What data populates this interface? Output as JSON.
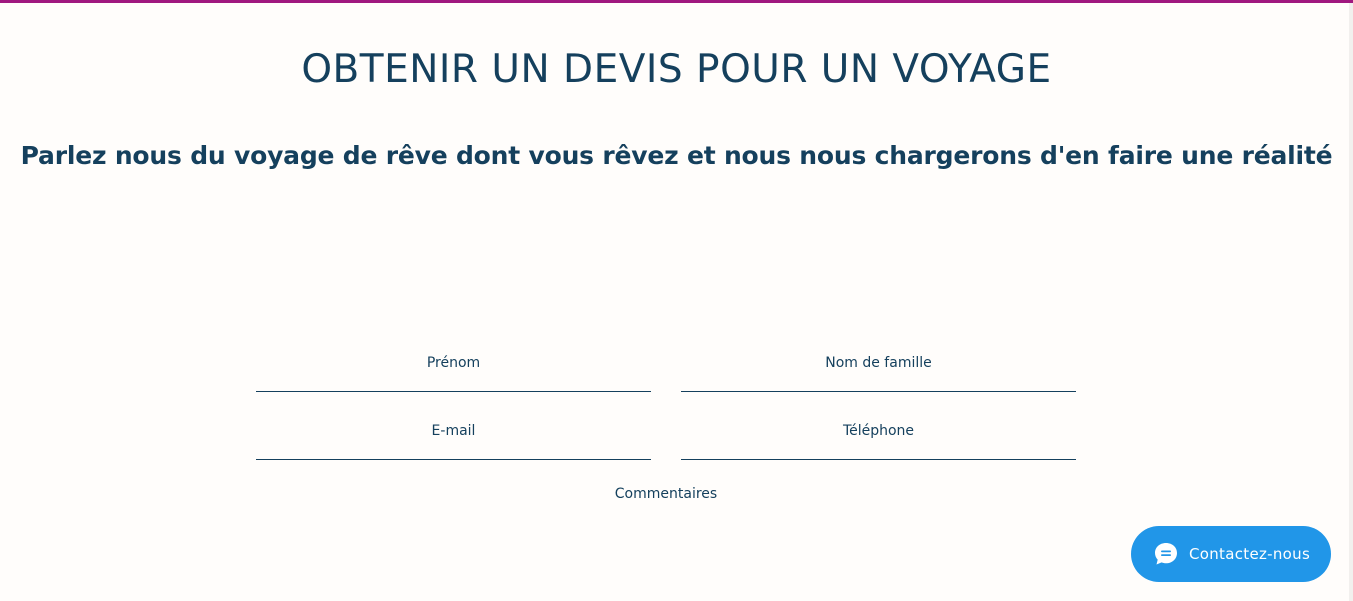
{
  "header": {
    "title": "OBTENIR UN DEVIS POUR UN VOYAGE",
    "subtitle": "Parlez nous du voyage de rêve dont vous rêvez et nous nous chargerons d'en faire une réalité"
  },
  "form": {
    "first_name": {
      "placeholder": "Prénom",
      "value": ""
    },
    "last_name": {
      "placeholder": "Nom de famille",
      "value": ""
    },
    "email": {
      "placeholder": "E-mail",
      "value": ""
    },
    "phone": {
      "placeholder": "Téléphone",
      "value": ""
    },
    "comments": {
      "placeholder": "Commentaires",
      "value": ""
    }
  },
  "chat_widget": {
    "label": "Contactez-nous",
    "icon": "chat-bubble-icon"
  },
  "colors": {
    "accent_bar": "#a0187f",
    "text_primary": "#15405d",
    "chat_button": "#2196e8",
    "background": "#fffdfb"
  }
}
